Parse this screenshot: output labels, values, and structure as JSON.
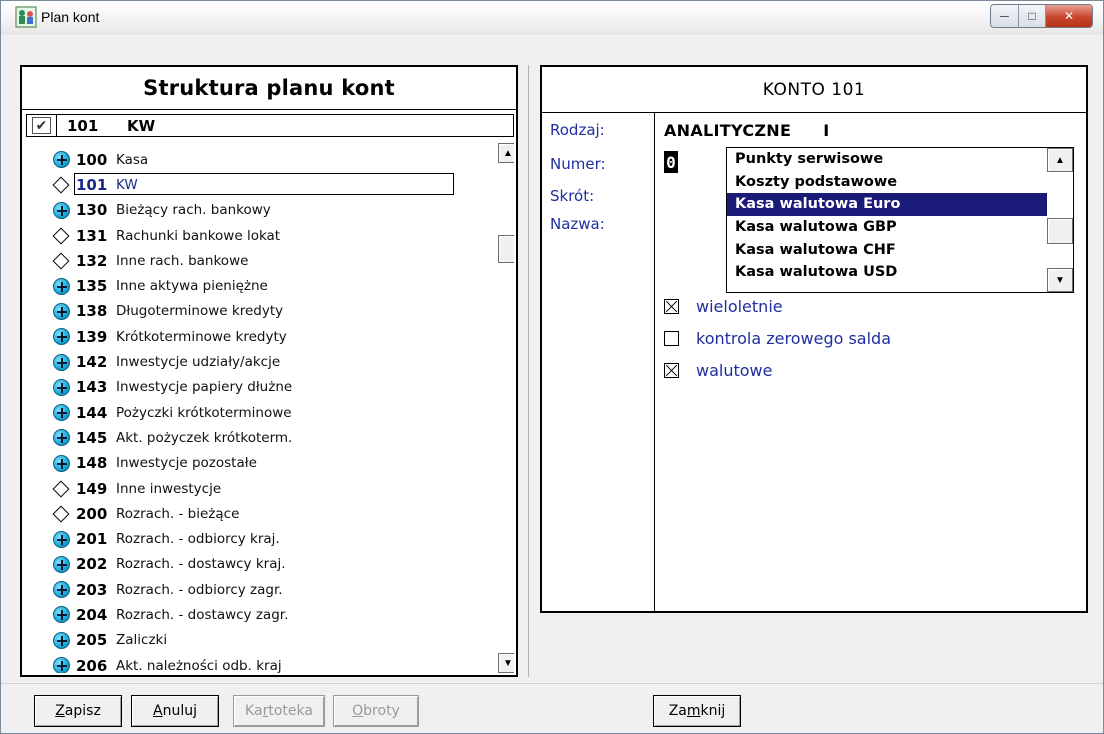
{
  "window": {
    "title": "Plan kont",
    "icon": "people-icon",
    "controls": [
      "minimize",
      "maximize",
      "close"
    ]
  },
  "left": {
    "header": "Struktura planu kont",
    "current": {
      "number": "101",
      "name": "KW"
    },
    "accounts": [
      {
        "number": "100",
        "name": "Kasa",
        "icon": "plus-expand-icon"
      },
      {
        "number": "101",
        "name": "KW",
        "icon": "leaf-diamond-icon",
        "selected": true
      },
      {
        "number": "130",
        "name": "Bieżący rach. bankowy",
        "icon": "plus-expand-icon"
      },
      {
        "number": "131",
        "name": "Rachunki bankowe lokat",
        "icon": "leaf-diamond-icon"
      },
      {
        "number": "132",
        "name": "Inne rach. bankowe",
        "icon": "leaf-diamond-icon"
      },
      {
        "number": "135",
        "name": "Inne aktywa pieniężne",
        "icon": "plus-expand-icon"
      },
      {
        "number": "138",
        "name": "Długoterminowe kredyty",
        "icon": "plus-expand-icon"
      },
      {
        "number": "139",
        "name": "Krótkoterminowe kredyty",
        "icon": "plus-expand-icon"
      },
      {
        "number": "142",
        "name": "Inwestycje udziały/akcje",
        "icon": "plus-expand-icon"
      },
      {
        "number": "143",
        "name": "Inwestycje papiery dłużne",
        "icon": "plus-expand-icon"
      },
      {
        "number": "144",
        "name": "Pożyczki krótkoterminowe",
        "icon": "plus-expand-icon"
      },
      {
        "number": "145",
        "name": "Akt. pożyczek krótkoterm.",
        "icon": "plus-expand-icon"
      },
      {
        "number": "148",
        "name": "Inwestycje pozostałe",
        "icon": "plus-expand-icon"
      },
      {
        "number": "149",
        "name": "Inne inwestycje",
        "icon": "leaf-diamond-icon"
      },
      {
        "number": "200",
        "name": "Rozrach. - bieżące",
        "icon": "leaf-diamond-icon"
      },
      {
        "number": "201",
        "name": "Rozrach. - odbiorcy kraj.",
        "icon": "plus-expand-icon"
      },
      {
        "number": "202",
        "name": "Rozrach. - dostawcy kraj.",
        "icon": "plus-expand-icon"
      },
      {
        "number": "203",
        "name": "Rozrach. - odbiorcy zagr.",
        "icon": "plus-expand-icon"
      },
      {
        "number": "204",
        "name": "Rozrach. - dostawcy zagr.",
        "icon": "plus-expand-icon"
      },
      {
        "number": "205",
        "name": "Zaliczki",
        "icon": "plus-expand-icon"
      },
      {
        "number": "206",
        "name": "Akt. należności odb. kraj",
        "icon": "plus-expand-icon"
      }
    ]
  },
  "right": {
    "header": "KONTO 101",
    "labels": {
      "rodzaj": "Rodzaj:",
      "numer": "Numer:",
      "skrot": "Skrót:",
      "nazwa": "Nazwa:"
    },
    "rodzaj_value": "ANALITYCZNE",
    "rodzaj_suffix": "I",
    "numer_value": "0",
    "dropdown_items": [
      {
        "label": "Punkty serwisowe",
        "active": false
      },
      {
        "label": "Koszty podstawowe",
        "active": false
      },
      {
        "label": "Kasa walutowa Euro",
        "active": true
      },
      {
        "label": "Kasa walutowa GBP",
        "active": false
      },
      {
        "label": "Kasa walutowa CHF",
        "active": false
      },
      {
        "label": "Kasa walutowa USD",
        "active": false
      }
    ],
    "checkboxes": [
      {
        "label": "wieloletnie",
        "checked": true
      },
      {
        "label": "kontrola zerowego salda",
        "checked": false
      },
      {
        "label": "walutowe",
        "checked": true
      }
    ]
  },
  "buttons": {
    "zapisz": {
      "pre": "",
      "u": "Z",
      "post": "apisz"
    },
    "anuluj": {
      "pre": "",
      "u": "A",
      "post": "nuluj"
    },
    "kartoteka": {
      "pre": "Ka",
      "u": "r",
      "post": "toteka"
    },
    "obroty": {
      "pre": "",
      "u": "O",
      "post": "broty"
    },
    "zamknij": {
      "pre": "Za",
      "u": "m",
      "post": "knij"
    }
  },
  "colors": {
    "label_blue": "#1f2ea0",
    "selection_navy": "#1a1a78",
    "plus_icon_cyan": "#17a7d8",
    "close_red": "#c7452c"
  }
}
